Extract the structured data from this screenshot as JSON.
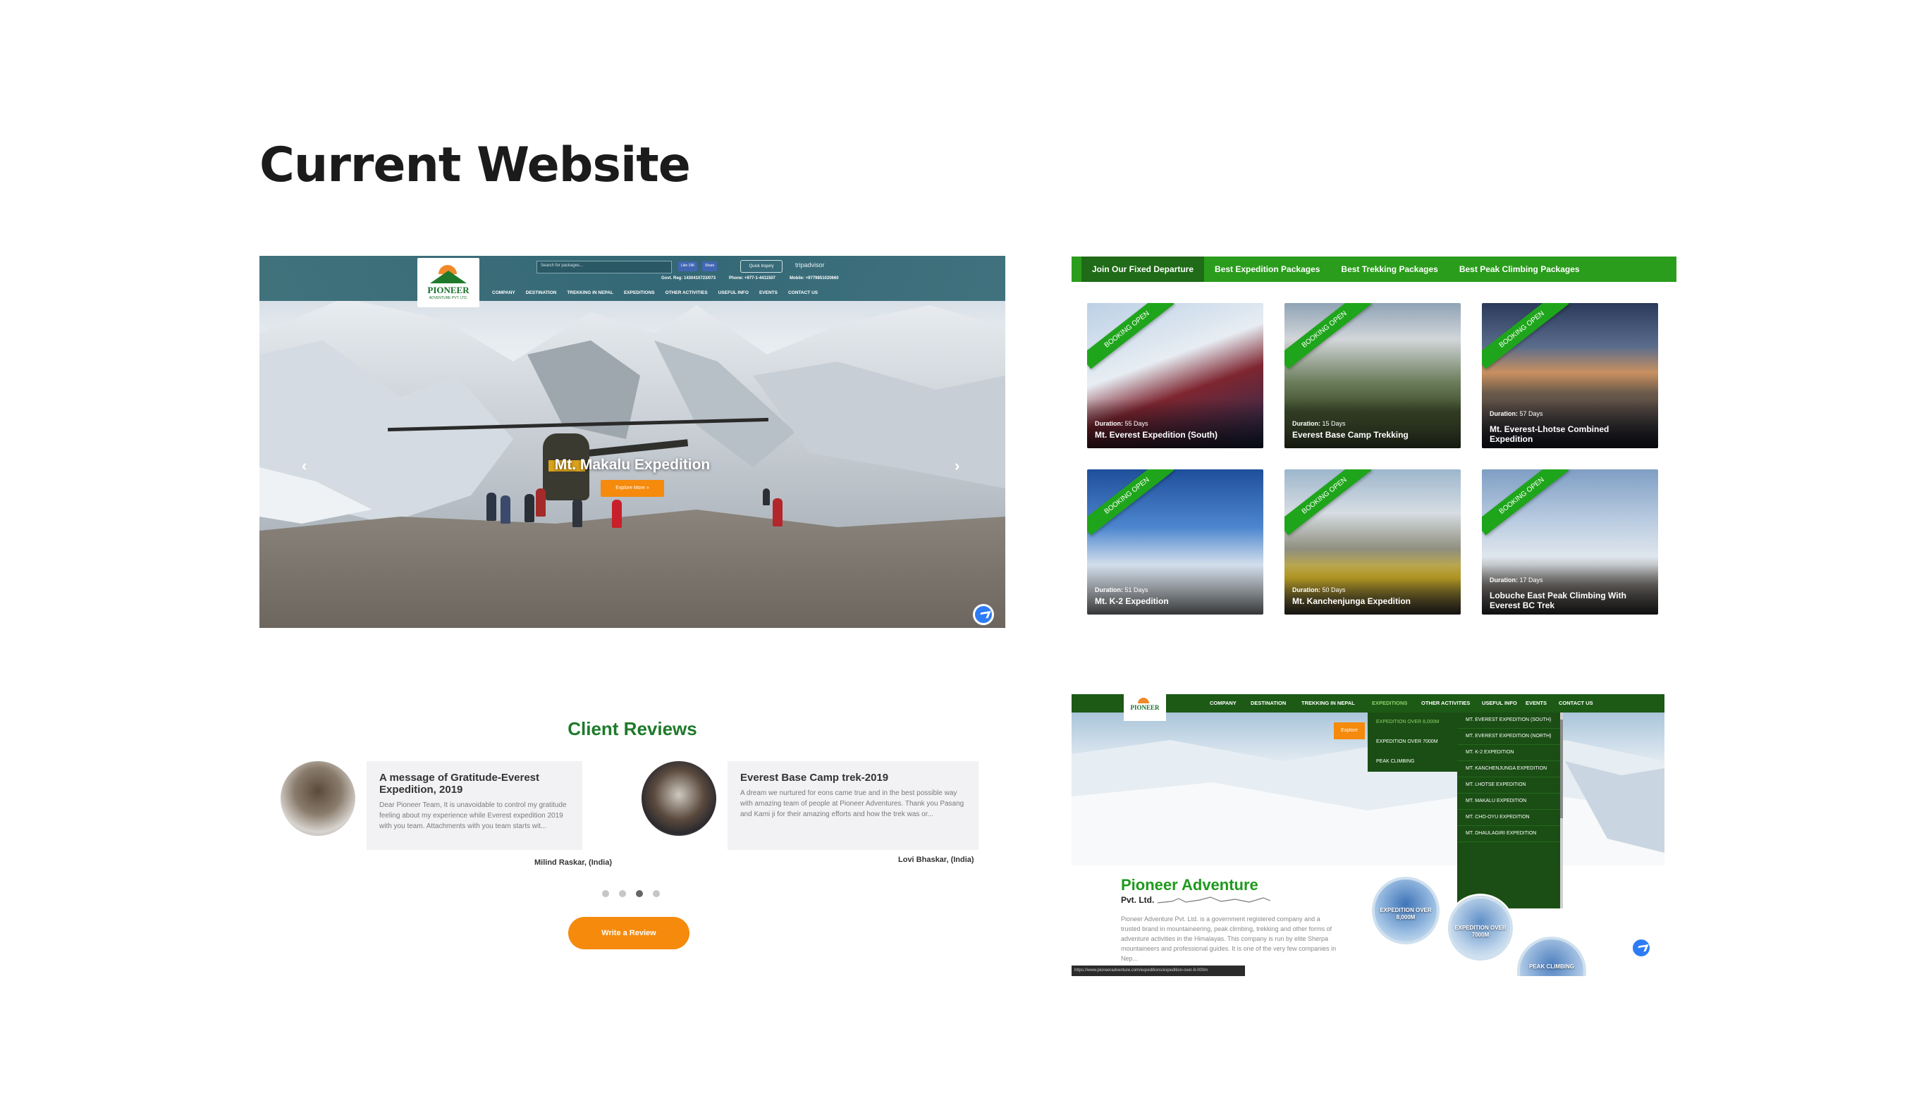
{
  "heading": "Current Website",
  "hero": {
    "logo_name": "PIONEER",
    "logo_sub": "ADVENTURE PVT. LTD.",
    "search_placeholder": "Search for packages...",
    "like_label": "Like 196",
    "share_label": "Share",
    "inquiry_label": "Quick Inquiry",
    "tripadvisor_label": "tripadvisor",
    "govt_reg": "Govt. Reg: 1430410723/073",
    "phone": "Phone: +977-1-4411507",
    "mobile": "Mobile: +9779851020660",
    "nav": [
      "COMPANY",
      "DESTINATION",
      "TREKKING IN NEPAL",
      "EXPEDITIONS",
      "OTHER ACTIVITIES",
      "USEFUL INFO",
      "EVENTS",
      "CONTACT US"
    ],
    "slide_title": "Mt. Makalu Expedition",
    "explore_label": "Explore More »",
    "prev_icon": "‹",
    "next_icon": "›"
  },
  "packages": {
    "tabs": [
      "Join Our Fixed Departure",
      "Best Expedition Packages",
      "Best Trekking Packages",
      "Best Peak Climbing Packages"
    ],
    "ribbon": "BOOKING OPEN",
    "duration_label": "Duration:",
    "cards": [
      {
        "days": "55 Days",
        "name": "Mt. Everest Expedition (South)"
      },
      {
        "days": "15 Days",
        "name": "Everest Base Camp Trekking"
      },
      {
        "days": "57 Days",
        "name": "Mt. Everest-Lhotse Combined Expedition"
      },
      {
        "days": "51 Days",
        "name": "Mt. K-2 Expedition"
      },
      {
        "days": "50 Days",
        "name": "Mt. Kanchenjunga Expedition"
      },
      {
        "days": "17 Days",
        "name": "Lobuche East Peak Climbing With Everest BC Trek"
      }
    ]
  },
  "reviews": {
    "title": "Client Reviews",
    "items": [
      {
        "title": "A message of Gratitude-Everest Expedition, 2019",
        "body": "Dear Pioneer Team, It is unavoidable to control my gratitude feeling about my experience while Everest expedition 2019 with you team. Attachments with you team starts wit...",
        "author": "Milind Raskar, (India)"
      },
      {
        "title": "Everest Base Camp trek-2019",
        "body": "A dream we nurtured for eons came true and in the best possible way with amazing team of people at Pioneer Adventures. Thank you Pasang and Kami ji for their amazing efforts and how the trek was or...",
        "author": "Lovi Bhaskar, (India)"
      }
    ],
    "write_label": "Write a Review"
  },
  "menu_page": {
    "logo_name": "PIONEER",
    "nav": [
      "COMPANY",
      "DESTINATION",
      "TREKKING IN NEPAL",
      "EXPEDITIONS",
      "OTHER ACTIVITIES",
      "USEFUL INFO",
      "EVENTS",
      "CONTACT US"
    ],
    "explore_label": "Explore",
    "submenu": [
      "EXPEDITION OVER 8,000M",
      "EXPEDITION OVER 7000M",
      "PEAK CLIMBING"
    ],
    "submenu2": [
      "MT. EVEREST EXPEDITION (SOUTH)",
      "MT. EVEREST EXPEDITION (NORTH)",
      "MT. K-2 EXPEDITION",
      "MT. KANCHENJUNGA EXPEDITION",
      "MT. LHOTSE EXPEDITION",
      "MT. MAKALU EXPEDITION",
      "MT. CHO-OYU EXPEDITION",
      "MT. DHAULAGIRI EXPEDITION"
    ],
    "company_title": "Pioneer Adventure",
    "company_sub": "Pvt. Ltd.",
    "company_desc": "Pioneer Adventure Pvt. Ltd. is a government registered company and a trusted brand in mountaineering, peak climbing, trekking and other forms of adventure activities in the Himalayas. This company is run by elite Sherpa mountaineers and professional guides. It is one of the very few companies in Nep...",
    "circles": [
      "EXPEDITION OVER 8,000M",
      "EXPEDITION OVER 7000M",
      "PEAK CLIMBING"
    ],
    "status_url": "https://www.pioneeradventure.com/expeditions/expedition-over-8-000m"
  }
}
